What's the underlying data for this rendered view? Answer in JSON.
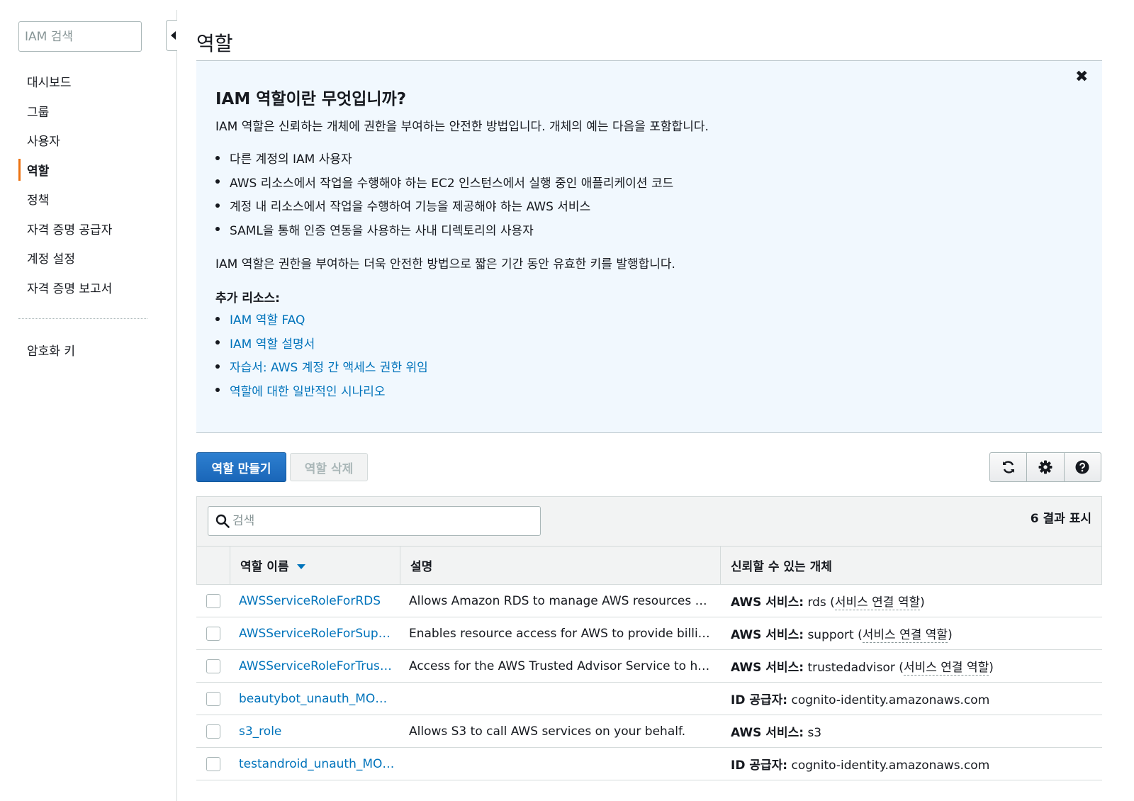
{
  "sidebar": {
    "search_placeholder": "IAM 검색",
    "items": [
      {
        "label": "대시보드"
      },
      {
        "label": "그룹"
      },
      {
        "label": "사용자"
      },
      {
        "label": "역할"
      },
      {
        "label": "정책"
      },
      {
        "label": "자격 증명 공급자"
      },
      {
        "label": "계정 설정"
      },
      {
        "label": "자격 증명 보고서"
      }
    ],
    "active_item": "역할",
    "secondary_items": [
      {
        "label": "암호화 키"
      }
    ]
  },
  "page": {
    "title": "역할"
  },
  "info": {
    "heading": "IAM 역할이란 무엇입니까?",
    "intro": "IAM 역할은 신뢰하는 개체에 권한을 부여하는 안전한 방법입니다. 개체의 예는 다음을 포함합니다.",
    "bullets": [
      "다른 계정의 IAM 사용자",
      "AWS 리소스에서 작업을 수행해야 하는 EC2 인스턴스에서 실행 중인 애플리케이션 코드",
      "계정 내 리소스에서 작업을 수행하여 기능을 제공해야 하는 AWS 서비스",
      "SAML을 통해 인증 연동을 사용하는 사내 디렉토리의 사용자"
    ],
    "summary": "IAM 역할은 권한을 부여하는 더욱 안전한 방법으로 짧은 기간 동안 유효한 키를 발행합니다.",
    "resources_label": "추가 리소스:",
    "links": [
      "IAM 역할 FAQ",
      "IAM 역할 설명서",
      "자습서: AWS 계정 간 액세스 권한 위임",
      "역할에 대한 일반적인 시나리오"
    ],
    "close_icon": "✖"
  },
  "toolbar": {
    "create_label": "역할 만들기",
    "delete_label": "역할 삭제",
    "icons": [
      "refresh-icon",
      "gear-icon",
      "help-icon"
    ]
  },
  "table": {
    "search_placeholder": "검색",
    "result_count": "6 결과 표시",
    "columns": [
      "역할 이름",
      "설명",
      "신뢰할 수 있는 개체"
    ],
    "rows": [
      {
        "name": "AWSServiceRoleForRDS",
        "description": "Allows Amazon RDS to manage AWS resources on your behalf",
        "entity_label": "AWS 서비스:",
        "entity_value": "rds",
        "entity_note": "서비스 연결 역할"
      },
      {
        "name": "AWSServiceRoleForSupport",
        "description": "Enables resource access for AWS to provide billing, administrative and support services",
        "entity_label": "AWS 서비스:",
        "entity_value": "support",
        "entity_note": "서비스 연결 역할"
      },
      {
        "name": "AWSServiceRoleForTrustedAdvisor",
        "description": "Access for the AWS Trusted Advisor Service to help reduce cost",
        "entity_label": "AWS 서비스:",
        "entity_value": "trustedadvisor",
        "entity_note": "서비스 연결 역할"
      },
      {
        "name": "beautybot_unauth_MOBILEHUB",
        "description": "",
        "entity_label": "ID 공급자:",
        "entity_value": "cognito-identity.amazonaws.com",
        "entity_note": ""
      },
      {
        "name": "s3_role",
        "description": "Allows S3 to call AWS services on your behalf.",
        "entity_label": "AWS 서비스:",
        "entity_value": "s3",
        "entity_note": ""
      },
      {
        "name": "testandroid_unauth_MOBILEHUB",
        "description": "",
        "entity_label": "ID 공급자:",
        "entity_value": "cognito-identity.amazonaws.com",
        "entity_note": ""
      }
    ]
  },
  "colors": {
    "accent": "#ec7211",
    "link": "#0073bb",
    "primary_button": "#1a66b8",
    "info_bg": "#f1f8fe"
  }
}
